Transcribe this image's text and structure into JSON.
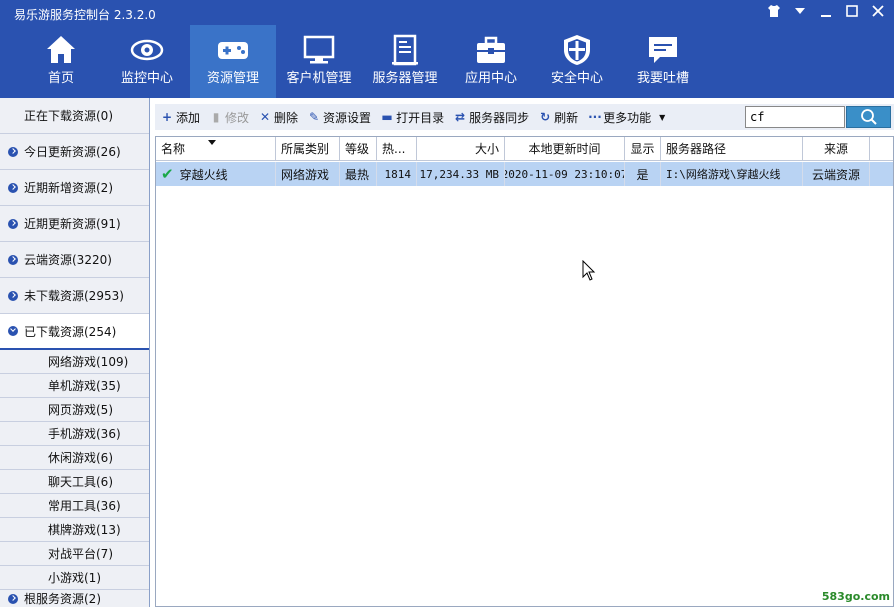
{
  "app": {
    "title": "易乐游服务控制台 2.3.2.0"
  },
  "nav": [
    {
      "label": "首页",
      "icon": "home-icon"
    },
    {
      "label": "监控中心",
      "icon": "eye-icon"
    },
    {
      "label": "资源管理",
      "icon": "gamepad-icon",
      "active": true
    },
    {
      "label": "客户机管理",
      "icon": "monitor-icon"
    },
    {
      "label": "服务器管理",
      "icon": "server-icon"
    },
    {
      "label": "应用中心",
      "icon": "toolbox-icon"
    },
    {
      "label": "安全中心",
      "icon": "shield-icon"
    },
    {
      "label": "我要吐槽",
      "icon": "chat-icon"
    }
  ],
  "sidebar": {
    "items": [
      {
        "label": "正在下载资源(0)"
      },
      {
        "label": "今日更新资源(26)"
      },
      {
        "label": "近期新增资源(2)"
      },
      {
        "label": "近期更新资源(91)"
      },
      {
        "label": "云端资源(3220)"
      },
      {
        "label": "未下载资源(2953)"
      },
      {
        "label": "已下载资源(254)"
      }
    ],
    "subitems": [
      {
        "label": "网络游戏(109)"
      },
      {
        "label": "单机游戏(35)"
      },
      {
        "label": "网页游戏(5)"
      },
      {
        "label": "手机游戏(36)"
      },
      {
        "label": "休闲游戏(6)"
      },
      {
        "label": "聊天工具(6)"
      },
      {
        "label": "常用工具(36)"
      },
      {
        "label": "棋牌游戏(13)"
      },
      {
        "label": "对战平台(7)"
      },
      {
        "label": "小游戏(1)"
      }
    ],
    "partial_item": "根服务资源(2)"
  },
  "toolbar": {
    "add": "添加",
    "edit": "修改",
    "delete": "删除",
    "settings": "资源设置",
    "open_dir": "打开目录",
    "sync": "服务器同步",
    "refresh": "刷新",
    "more": "更多功能"
  },
  "search": {
    "value": "cf"
  },
  "table": {
    "columns": [
      "名称",
      "所属类别",
      "等级",
      "热...",
      "大小",
      "本地更新时间",
      "显示",
      "服务器路径",
      "来源"
    ],
    "rows": [
      {
        "name": "穿越火线",
        "category": "网络游戏",
        "level": "最热",
        "heat": "1814",
        "size": "17,234.33 MB",
        "updated": "2020-11-09 23:10:07",
        "display": "是",
        "path": "I:\\网络游戏\\穿越火线",
        "source": "云端资源"
      }
    ]
  },
  "watermark": "583go.com",
  "colors": {
    "header": "#2a52b0",
    "active_tab": "#3a73c8",
    "selected_row": "#b9d3f3",
    "search_button": "#3a8fc8"
  }
}
